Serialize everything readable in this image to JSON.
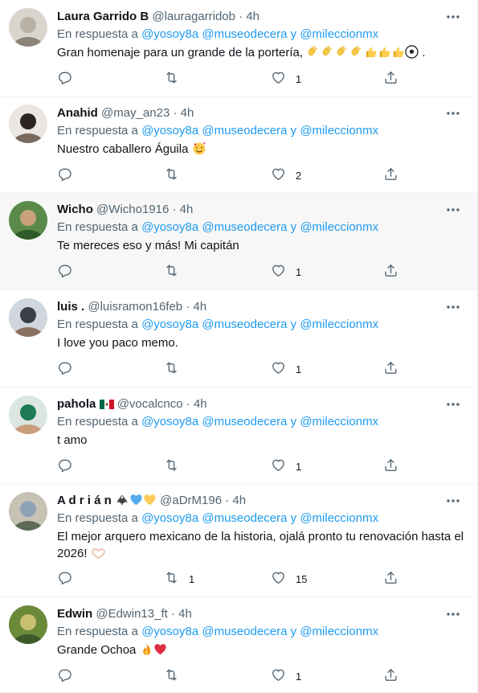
{
  "reply_prefix": "En respuesta a",
  "reply_mentions": [
    "@yosoy8a",
    "@museodecera",
    "y",
    "@mileccionmx"
  ],
  "tweets": [
    {
      "name": "Laura Garrido B",
      "handle": "@lauragarridob",
      "time": "4h",
      "text": "Gran homenaje para un grande de la portería,",
      "emojis": "clap-clap-clap-clap-thumbs-thumbs-thumbs-soccer",
      "text_suffix": " .",
      "replies": "",
      "retweets": "",
      "likes": "1"
    },
    {
      "name": "Anahid",
      "handle": "@may_an23",
      "time": "4h",
      "text": "Nuestro caballero Águila",
      "emojis": "smiling-hearts",
      "replies": "",
      "retweets": "",
      "likes": "2"
    },
    {
      "name": "Wicho",
      "handle": "@Wicho1916",
      "time": "4h",
      "text": "Te mereces eso y más! Mi capitán",
      "replies": "",
      "retweets": "",
      "likes": "1"
    },
    {
      "name": "luis .",
      "handle": "@luisramon16feb",
      "time": "4h",
      "text": "I love you paco memo.",
      "replies": "",
      "retweets": "",
      "likes": "1"
    },
    {
      "name": "pahola",
      "name_emoji": "mexico-flag",
      "handle": "@vocalcnco",
      "time": "4h",
      "text": "t amo",
      "replies": "",
      "retweets": "",
      "likes": "1"
    },
    {
      "name": "A d r i á n",
      "name_emoji": "eagle-blue-heart-yellow-heart",
      "handle": "@aDrM196",
      "time": "4h",
      "text": "El mejor arquero mexicano de la historia, ojalá pronto tu renovación hasta el 2026!",
      "emojis": "heart-hands",
      "replies": "",
      "retweets": "1",
      "likes": "15"
    },
    {
      "name": "Edwin",
      "handle": "@Edwin13_ft",
      "time": "4h",
      "text": "Grande Ochoa",
      "emojis": "fire-red-heart",
      "replies": "",
      "retweets": "",
      "likes": "1"
    }
  ],
  "colors": {
    "mention": "#1d9bf0",
    "muted": "#536471",
    "text": "#0f1419",
    "highlight_bg": "#f7f7f7"
  },
  "icons": [
    "reply-icon",
    "retweet-icon",
    "like-icon",
    "share-icon",
    "more-icon"
  ]
}
